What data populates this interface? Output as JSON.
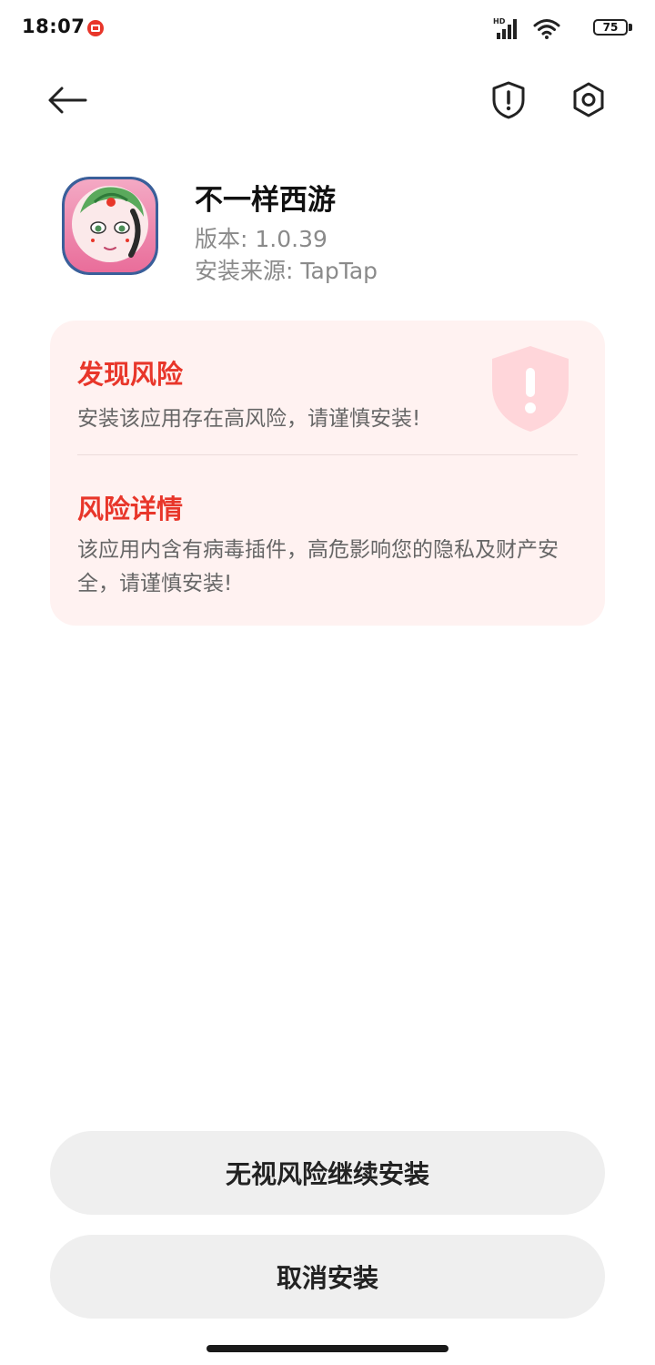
{
  "status_bar": {
    "time": "18:07",
    "network_label": "HD",
    "battery": "75"
  },
  "toolbar": {
    "back_icon": "arrow-left-icon",
    "shield_icon": "shield-alert-icon",
    "settings_icon": "settings-icon"
  },
  "app": {
    "name": "不一样西游",
    "version": "版本: 1.0.39",
    "source": "安装来源: TapTap"
  },
  "risk": {
    "title": "发现风险",
    "description": "安装该应用存在高风险，请谨慎安装!",
    "detail_title": "风险详情",
    "detail_description": "该应用内含有病毒插件，高危影响您的隐私及财产安全，请谨慎安装!"
  },
  "actions": {
    "continue_label": "无视风险继续安装",
    "cancel_label": "取消安装"
  },
  "colors": {
    "risk_red": "#e8362a",
    "card_background": "#fff2f1",
    "button_background": "#efefef",
    "muted_text": "#8a8a8a"
  }
}
